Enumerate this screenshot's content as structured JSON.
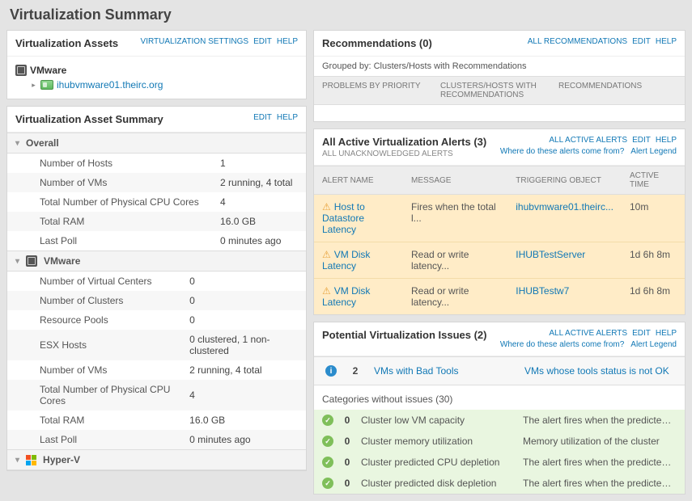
{
  "page_title": "Virtualization Summary",
  "left": {
    "assets": {
      "title": "Virtualization Assets",
      "links": [
        "VIRTUALIZATION SETTINGS",
        "EDIT",
        "HELP"
      ],
      "root": "VMware",
      "child": "ihubvmware01.theirc.org"
    },
    "summary": {
      "title": "Virtualization Asset Summary",
      "links": [
        "EDIT",
        "HELP"
      ],
      "sections": [
        {
          "name": "Overall",
          "icon": "",
          "rows": [
            {
              "k": "Number of Hosts",
              "v": "1"
            },
            {
              "k": "Number of VMs",
              "v": "2 running, 4 total"
            },
            {
              "k": "Total Number of Physical CPU Cores",
              "v": "4"
            },
            {
              "k": "Total RAM",
              "v": "16.0 GB"
            },
            {
              "k": "Last Poll",
              "v": "0 minutes ago"
            }
          ]
        },
        {
          "name": "VMware",
          "icon": "vm",
          "rows": [
            {
              "k": "Number of Virtual Centers",
              "v": "0"
            },
            {
              "k": "Number of Clusters",
              "v": "0"
            },
            {
              "k": "Resource Pools",
              "v": "0"
            },
            {
              "k": "ESX Hosts",
              "v": "0 clustered, 1 non-clustered"
            },
            {
              "k": "Number of VMs",
              "v": "2 running, 4 total"
            },
            {
              "k": "Total Number of Physical CPU Cores",
              "v": "4"
            },
            {
              "k": "Total RAM",
              "v": "16.0 GB"
            },
            {
              "k": "Last Poll",
              "v": "0 minutes ago"
            }
          ]
        },
        {
          "name": "Hyper-V",
          "icon": "hv",
          "rows": []
        }
      ]
    }
  },
  "right": {
    "recs": {
      "title": "Recommendations (0)",
      "links": [
        "ALL RECOMMENDATIONS",
        "EDIT",
        "HELP"
      ],
      "grouped": "Grouped by: Clusters/Hosts with Recommendations",
      "cols": [
        "PROBLEMS BY PRIORITY",
        "CLUSTERS/HOSTS WITH RECOMMENDATIONS",
        "RECOMMENDATIONS"
      ]
    },
    "alerts": {
      "title": "All Active Virtualization Alerts (3)",
      "sub": "ALL UNACKNOWLEDGED ALERTS",
      "links": [
        "ALL ACTIVE ALERTS",
        "EDIT",
        "HELP"
      ],
      "sublinks": [
        "Where do these alerts come from?",
        "Alert Legend"
      ],
      "cols": [
        "ALERT NAME",
        "MESSAGE",
        "TRIGGERING OBJECT",
        "ACTIVE TIME"
      ],
      "rows": [
        {
          "name": "Host to Datastore Latency",
          "msg": "Fires when the total l...",
          "obj": "ihubvmware01.theirc...",
          "time": "10m"
        },
        {
          "name": "VM Disk Latency",
          "msg": "Read or write latency...",
          "obj": "IHUBTestServer",
          "time": "1d 6h 8m"
        },
        {
          "name": "VM Disk Latency",
          "msg": "Read or write latency...",
          "obj": "IHUBTestw7",
          "time": "1d 6h 8m"
        }
      ]
    },
    "issues": {
      "title": "Potential Virtualization Issues (2)",
      "links": [
        "ALL ACTIVE ALERTS",
        "EDIT",
        "HELP"
      ],
      "sublinks": [
        "Where do these alerts come from?",
        "Alert Legend"
      ],
      "top": {
        "count": "2",
        "name": "VMs with Bad Tools",
        "desc": "VMs whose tools status is not OK"
      },
      "cat_note": "Categories without issues (30)",
      "rows": [
        {
          "cnt": "0",
          "name": "Cluster low VM capacity",
          "desc": "The alert fires when the predicted numb..."
        },
        {
          "cnt": "0",
          "name": "Cluster memory utilization",
          "desc": "Memory utilization of the cluster"
        },
        {
          "cnt": "0",
          "name": "Cluster predicted CPU depletion",
          "desc": "The alert fires when the predicted time r..."
        },
        {
          "cnt": "0",
          "name": "Cluster predicted disk depletion",
          "desc": "The alert fires when the predicted time r..."
        }
      ]
    }
  }
}
